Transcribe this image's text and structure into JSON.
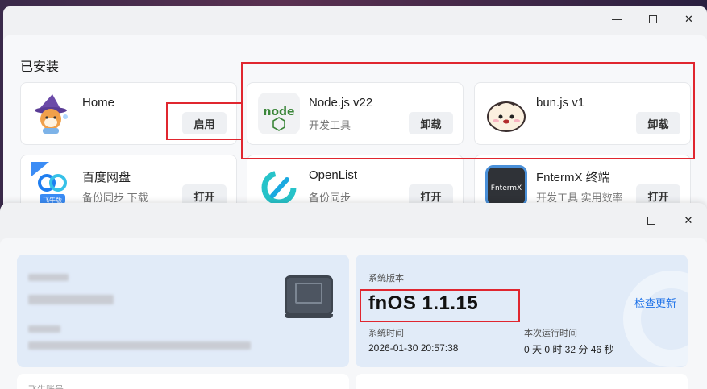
{
  "top_window": {
    "section_title": "已安装",
    "apps": [
      {
        "name": "Home",
        "desc": "",
        "button": "启用",
        "icon": "shiba-wizard-icon"
      },
      {
        "name": "Node.js v22",
        "desc": "开发工具",
        "button": "卸载",
        "icon": "nodejs-icon",
        "icon_text": "node"
      },
      {
        "name": "bun.js v1",
        "desc": "",
        "button": "卸载",
        "icon": "bun-icon"
      },
      {
        "name": "百度网盘",
        "desc": "备份同步 下载",
        "button": "打开",
        "icon": "baidu-netdisk-icon",
        "icon_text": "飞牛版"
      },
      {
        "name": "OpenList",
        "desc": "备份同步",
        "button": "打开",
        "icon": "openlist-icon"
      },
      {
        "name": "FntermX 终端",
        "desc": "开发工具 实用效率",
        "button": "打开",
        "icon": "terminal-icon",
        "icon_text": "FntermX"
      }
    ],
    "controls": {
      "minimize": "minimize-icon",
      "maximize": "maximize-icon",
      "close": "✕"
    }
  },
  "bottom_window": {
    "controls": {
      "minimize": "minimize-icon",
      "maximize": "maximize-icon",
      "close": "✕"
    },
    "system": {
      "version_label": "系统版本",
      "version": "fnOS  1.1.15",
      "check_update": "检查更新",
      "time_label": "系统时间",
      "time_value": "2026-01-30 20:57:38",
      "uptime_label": "本次运行时间",
      "uptime_value": "0 天 0 时 32 分 46 秒"
    },
    "account_label": "飞牛账号"
  },
  "colors": {
    "highlight_red": "#e0262f",
    "link_blue": "#1e72e8",
    "panel_blue": "#e1ebf8"
  }
}
